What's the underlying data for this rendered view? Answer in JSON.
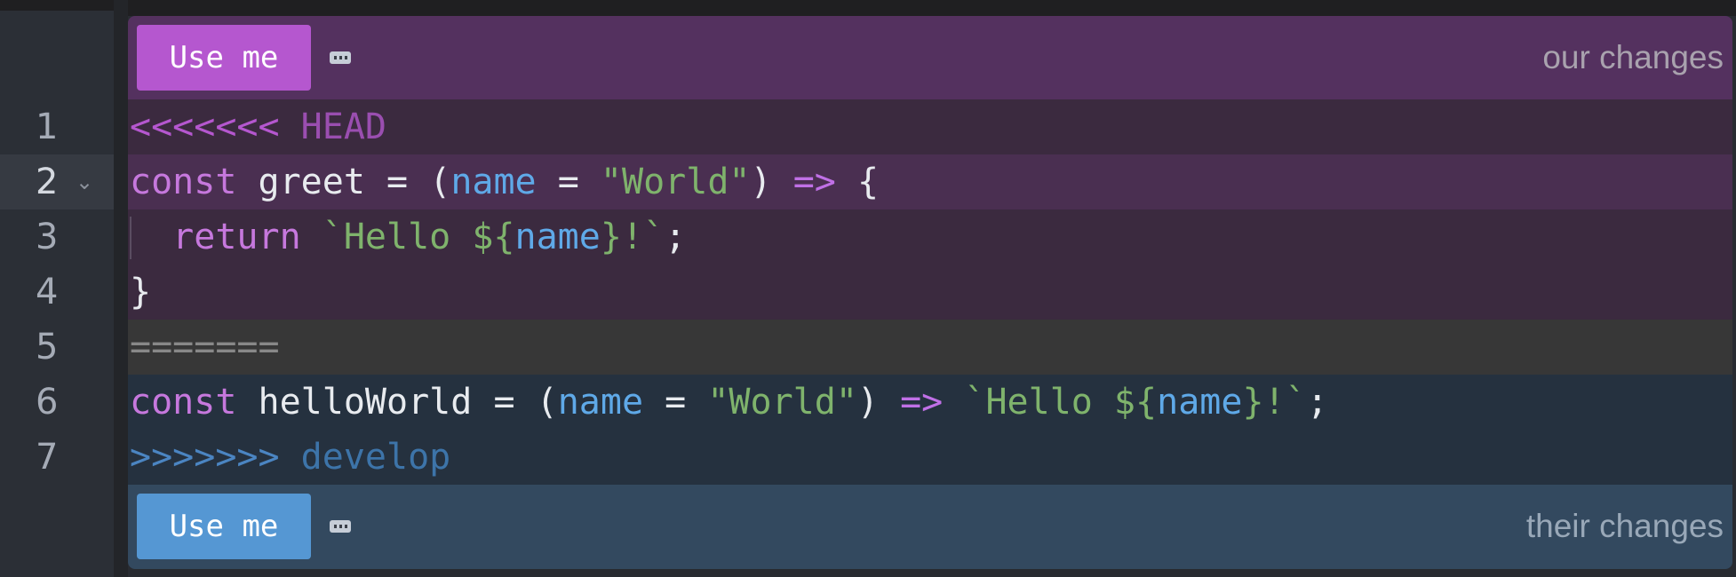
{
  "gutter": {
    "line_numbers": [
      "1",
      "2",
      "3",
      "4",
      "5",
      "6",
      "7"
    ],
    "active_line": 2,
    "fold_icon": "chevron-down-icon"
  },
  "conflict": {
    "ours": {
      "button_label": "Use me",
      "label": "our changes",
      "color": "#b557cf",
      "background": "#54315f"
    },
    "theirs": {
      "button_label": "Use me",
      "label": "their changes",
      "color": "#5597d3",
      "background": "#33495f"
    },
    "options_icon": "more-options-icon"
  },
  "code": {
    "line1": {
      "marker": "<<<<<<<",
      "ref": "HEAD"
    },
    "line2": {
      "keyword": "const",
      "name": "greet",
      "eq1": "=",
      "open_paren": "(",
      "param": "name",
      "eq2": "=",
      "string": "\"World\"",
      "close_paren": ")",
      "arrow": "=>",
      "brace": "{"
    },
    "line3": {
      "keyword": "return",
      "template_start": "`Hello ${",
      "template_var": "name",
      "template_end": "}!`",
      "semicolon": ";"
    },
    "line4": {
      "brace": "}"
    },
    "line5": {
      "separator": "======="
    },
    "line6": {
      "keyword": "const",
      "name": "helloWorld",
      "eq1": "=",
      "open_paren": "(",
      "param": "name",
      "eq2": "=",
      "string": "\"World\"",
      "close_paren": ")",
      "arrow": "=>",
      "template_start": "`Hello ${",
      "template_var": "name",
      "template_end": "}!`",
      "semicolon": ";"
    },
    "line7": {
      "marker": ">>>>>>>",
      "ref": "develop"
    }
  }
}
